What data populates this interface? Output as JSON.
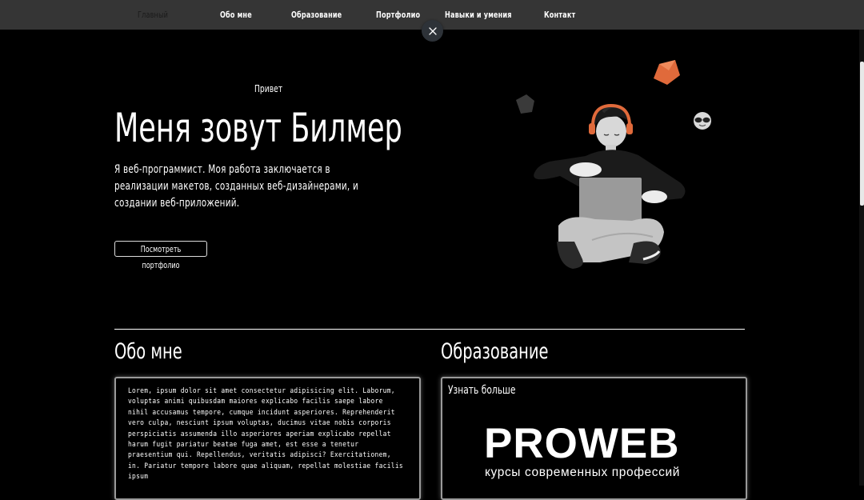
{
  "nav": {
    "items": [
      {
        "label": "Главный",
        "active": true
      },
      {
        "label": "Обо мне",
        "active": false
      },
      {
        "label": "Образование",
        "active": false
      },
      {
        "label": "Портфолио",
        "active": false
      },
      {
        "label": "Навыки и умения",
        "active": false
      },
      {
        "label": "Контакт",
        "active": false
      }
    ],
    "close_icon": "close-icon"
  },
  "hero": {
    "greeting": "Привет",
    "title": "Меня зовут Билмер",
    "description": "Я веб-программист. Моя работа заключается в реализации макетов, созданных веб-дизайнерами, и создании веб-приложений.",
    "button_label": "Посмотреть портфолио"
  },
  "about": {
    "title": "Обо мне",
    "text": "Lorem, ipsum dolor sit amet consectetur adipisicing elit. Laborum, voluptas animi quibusdam maiores explicabo facilis saepe labore nihil accusamus tempore, cumque incidunt asperiores. Reprehenderit vero culpa, nesciunt ipsum voluptas, ducimus vitae nobis corporis perspiciatis assumenda illo asperiores aperiam explicabo repellat harum fugit pariatur beatae fuga amet, est esse a tenetur praesentium qui. Repellendus, veritatis adipisci? Exercitationem, in. Pariatur tempore labore quae aliquam, repellat molestiae facilis ipsum"
  },
  "education": {
    "title": "Образование",
    "learn_more": "Узнать больше",
    "logo_text": "PROWEB",
    "logo_subtitle": "курсы современных профессий"
  },
  "colors": {
    "background": "#000000",
    "navbar": "#353535",
    "accent": "#e06a3b"
  }
}
